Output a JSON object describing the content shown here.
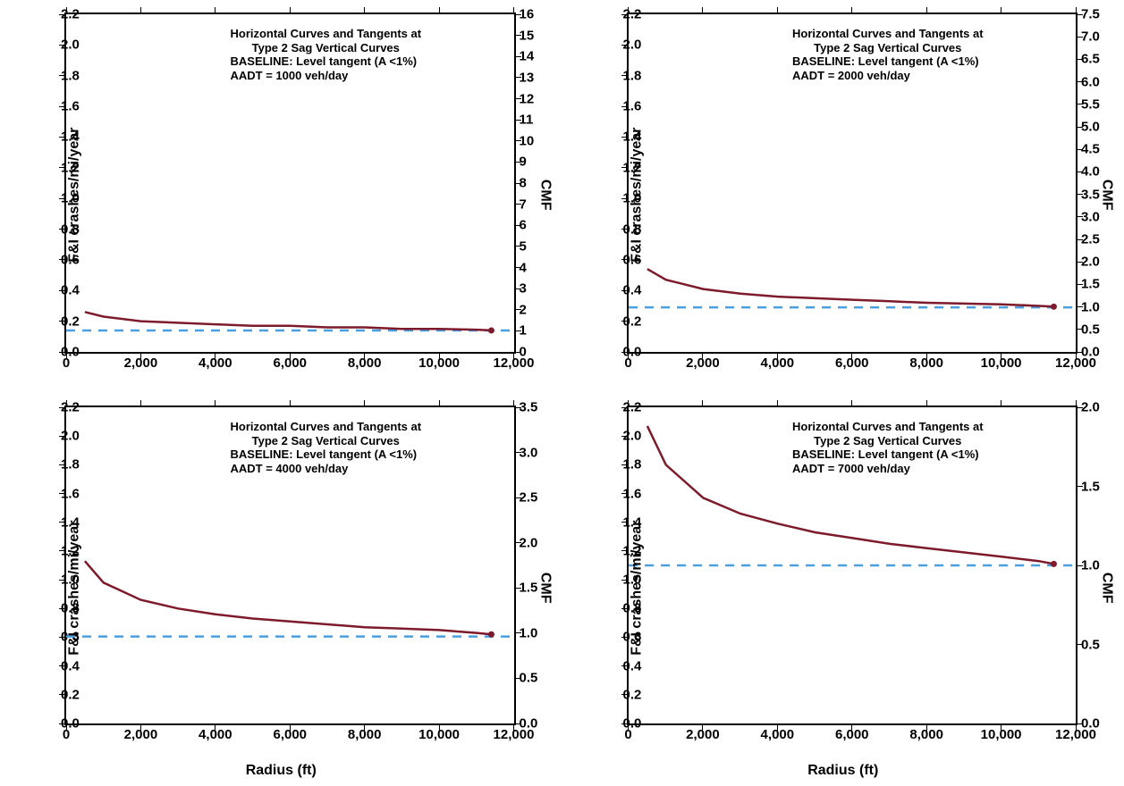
{
  "ylabel_left": "F&I crashes/mi/year",
  "ylabel_right": "CMF",
  "xlabel": "Radius (ft)",
  "annot_line1": "Horizontal Curves and Tangents at",
  "annot_line2": "Type 2 Sag Vertical Curves",
  "annot_line3": "BASELINE: Level tangent (A <1%)",
  "panels": [
    {
      "aadt_label": "AADT = 1000 veh/day"
    },
    {
      "aadt_label": "AADT = 2000 veh/day"
    },
    {
      "aadt_label": "AADT = 4000 veh/day"
    },
    {
      "aadt_label": "AADT = 7000 veh/day"
    }
  ],
  "chart_data": [
    {
      "type": "line",
      "title": "Horizontal Curves and Tangents at Type 2 Sag Vertical Curves — BASELINE: Level tangent (A <1%) — AADT = 1000 veh/day",
      "xlabel": "Radius (ft)",
      "ylabel_left": "F&I crashes/mi/year",
      "ylabel_right": "CMF",
      "xlim": [
        0,
        12000
      ],
      "ylim_left": [
        0.0,
        2.2
      ],
      "yticks_left": [
        0.0,
        0.2,
        0.4,
        0.6,
        0.8,
        1.0,
        1.2,
        1.4,
        1.6,
        1.8,
        2.0,
        2.2
      ],
      "ylim_right": [
        0,
        16
      ],
      "yticks_right": [
        0,
        1,
        2,
        3,
        4,
        5,
        6,
        7,
        8,
        9,
        10,
        11,
        12,
        13,
        14,
        15,
        16
      ],
      "xticks": [
        0,
        2000,
        4000,
        6000,
        8000,
        10000,
        12000
      ],
      "baseline_left_y": 0.14,
      "series": [
        {
          "name": "baseline",
          "style": "dashed",
          "color": "#4a9fe0",
          "x": [
            0,
            12000
          ],
          "y_left": [
            0.14,
            0.14
          ]
        },
        {
          "name": "F&I crashes",
          "style": "solid",
          "color": "#7d1a2b",
          "x": [
            500,
            1000,
            2000,
            3000,
            4000,
            5000,
            6000,
            7000,
            8000,
            9000,
            10000,
            11000,
            11400
          ],
          "y_left": [
            0.26,
            0.23,
            0.2,
            0.19,
            0.18,
            0.17,
            0.17,
            0.16,
            0.16,
            0.15,
            0.15,
            0.145,
            0.14
          ]
        }
      ]
    },
    {
      "type": "line",
      "title": "Horizontal Curves and Tangents at Type 2 Sag Vertical Curves — BASELINE: Level tangent (A <1%) — AADT = 2000 veh/day",
      "xlabel": "Radius (ft)",
      "ylabel_left": "F&I crashes/mi/year",
      "ylabel_right": "CMF",
      "xlim": [
        0,
        12000
      ],
      "ylim_left": [
        0.0,
        2.2
      ],
      "yticks_left": [
        0.0,
        0.2,
        0.4,
        0.6,
        0.8,
        1.0,
        1.2,
        1.4,
        1.6,
        1.8,
        2.0,
        2.2
      ],
      "ylim_right": [
        0.0,
        7.5
      ],
      "yticks_right": [
        0.0,
        0.5,
        1.0,
        1.5,
        2.0,
        2.5,
        3.0,
        3.5,
        4.0,
        4.5,
        5.0,
        5.5,
        6.0,
        6.5,
        7.0,
        7.5
      ],
      "xticks": [
        0,
        2000,
        4000,
        6000,
        8000,
        10000,
        12000
      ],
      "baseline_left_y": 0.29,
      "series": [
        {
          "name": "baseline",
          "style": "dashed",
          "color": "#4a9fe0",
          "x": [
            0,
            12000
          ],
          "y_left": [
            0.29,
            0.29
          ]
        },
        {
          "name": "F&I crashes",
          "style": "solid",
          "color": "#7d1a2b",
          "x": [
            500,
            1000,
            2000,
            3000,
            4000,
            5000,
            6000,
            7000,
            8000,
            9000,
            10000,
            11000,
            11400
          ],
          "y_left": [
            0.54,
            0.47,
            0.41,
            0.38,
            0.36,
            0.35,
            0.34,
            0.33,
            0.32,
            0.315,
            0.31,
            0.3,
            0.295
          ]
        }
      ]
    },
    {
      "type": "line",
      "title": "Horizontal Curves and Tangents at Type 2 Sag Vertical Curves — BASELINE: Level tangent (A <1%) — AADT = 4000 veh/day",
      "xlabel": "Radius (ft)",
      "ylabel_left": "F&I crashes/mi/year",
      "ylabel_right": "CMF",
      "xlim": [
        0,
        12000
      ],
      "ylim_left": [
        0.0,
        2.2
      ],
      "yticks_left": [
        0.0,
        0.2,
        0.4,
        0.6,
        0.8,
        1.0,
        1.2,
        1.4,
        1.6,
        1.8,
        2.0,
        2.2
      ],
      "ylim_right": [
        0.0,
        3.5
      ],
      "yticks_right": [
        0.0,
        0.5,
        1.0,
        1.5,
        2.0,
        2.5,
        3.0,
        3.5
      ],
      "xticks": [
        0,
        2000,
        4000,
        6000,
        8000,
        10000,
        12000
      ],
      "baseline_left_y": 0.605,
      "series": [
        {
          "name": "baseline",
          "style": "dashed",
          "color": "#4a9fe0",
          "x": [
            0,
            12000
          ],
          "y_left": [
            0.605,
            0.605
          ]
        },
        {
          "name": "F&I crashes",
          "style": "solid",
          "color": "#7d1a2b",
          "x": [
            500,
            1000,
            2000,
            3000,
            4000,
            5000,
            6000,
            7000,
            8000,
            9000,
            10000,
            11000,
            11400
          ],
          "y_left": [
            1.13,
            0.98,
            0.86,
            0.8,
            0.76,
            0.73,
            0.71,
            0.69,
            0.67,
            0.66,
            0.65,
            0.63,
            0.62
          ]
        }
      ]
    },
    {
      "type": "line",
      "title": "Horizontal Curves and Tangents at Type 2 Sag Vertical Curves — BASELINE: Level tangent (A <1%) — AADT = 7000 veh/day",
      "xlabel": "Radius (ft)",
      "ylabel_left": "F&I crashes/mi/year",
      "ylabel_right": "CMF",
      "xlim": [
        0,
        12000
      ],
      "ylim_left": [
        0.0,
        2.2
      ],
      "yticks_left": [
        0.0,
        0.2,
        0.4,
        0.6,
        0.8,
        1.0,
        1.2,
        1.4,
        1.6,
        1.8,
        2.0,
        2.2
      ],
      "ylim_right": [
        0.0,
        2.0
      ],
      "yticks_right": [
        0.0,
        0.5,
        1.0,
        1.5,
        2.0
      ],
      "xticks": [
        0,
        2000,
        4000,
        6000,
        8000,
        10000,
        12000
      ],
      "baseline_left_y": 1.1,
      "series": [
        {
          "name": "baseline",
          "style": "dashed",
          "color": "#4a9fe0",
          "x": [
            0,
            12000
          ],
          "y_left": [
            1.1,
            1.1
          ]
        },
        {
          "name": "F&I crashes",
          "style": "solid",
          "color": "#7d1a2b",
          "x": [
            500,
            1000,
            2000,
            3000,
            4000,
            5000,
            6000,
            7000,
            8000,
            9000,
            10000,
            11000,
            11400
          ],
          "y_left": [
            2.07,
            1.8,
            1.57,
            1.46,
            1.39,
            1.33,
            1.29,
            1.25,
            1.22,
            1.19,
            1.16,
            1.13,
            1.11
          ]
        }
      ]
    }
  ]
}
